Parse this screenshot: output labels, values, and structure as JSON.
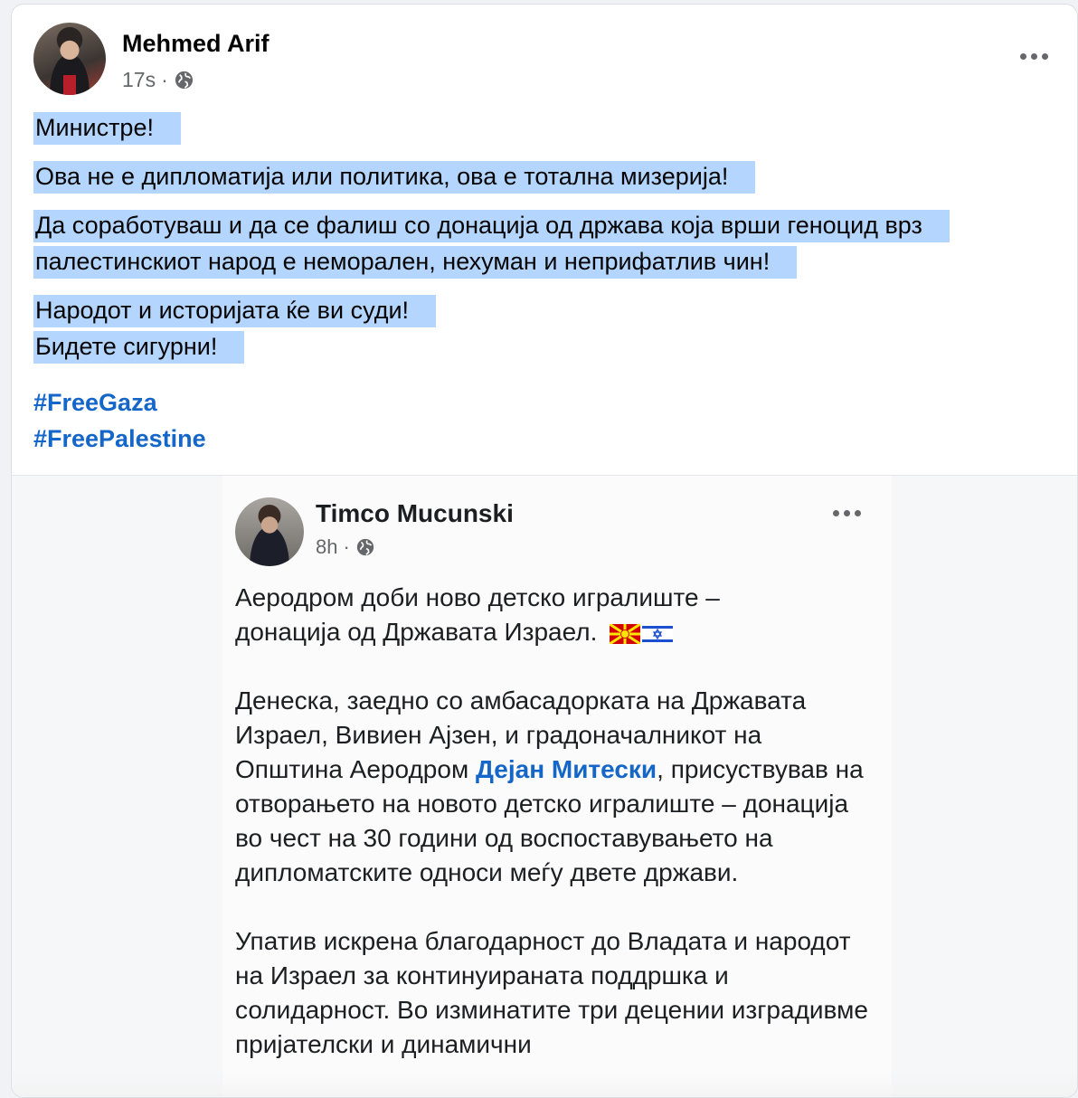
{
  "post": {
    "author": "Mehmed Arif",
    "time": "17s",
    "separator": "·",
    "icons": {
      "privacy": "globe-icon",
      "more": "more-options-icon"
    },
    "paragraphs": [
      [
        "Министре!"
      ],
      [
        "Ова не е дипломатија или политика, ова е тотална мизерија!"
      ],
      [
        "Да соработуваш и да се фалиш со донација од држава која врши геноцид врз палестинскиот народ е неморален, нехуман и неприфатлив чин!"
      ],
      [
        "Народот и историјата ќе ви суди!",
        "Бидете сигурни!"
      ]
    ],
    "hashtags": [
      "#FreeGaza",
      "#FreePalestine"
    ],
    "highlight_color": "#b4d5fe",
    "link_color": "#1466c8"
  },
  "shared_post": {
    "author": "Timco Mucunski",
    "time": "8h",
    "separator": "·",
    "line1": "Аеродром доби ново детско игралиште –",
    "line2": "донација од Државата Израел.",
    "flags": [
      "macedonia-flag-icon",
      "israel-flag-icon"
    ],
    "p2_before": "Денеска, заедно со амбасадорката на Државата Израел, Вивиен Ајзен, и градоначалникот на Општина Аеродром ",
    "mention": "Дејан Митески",
    "p2_after": ", присуствував на отворањето на новото детско игралиште – донација во чест на 30 години од воспоставувањето на дипломатските односи меѓу двете држави.",
    "p3": "Упатив искрена благодарност до Владата и народот на Израел за континуиранaта поддршка и солидарност. Во изминатите три децении изградивме пријателски и динамични"
  }
}
